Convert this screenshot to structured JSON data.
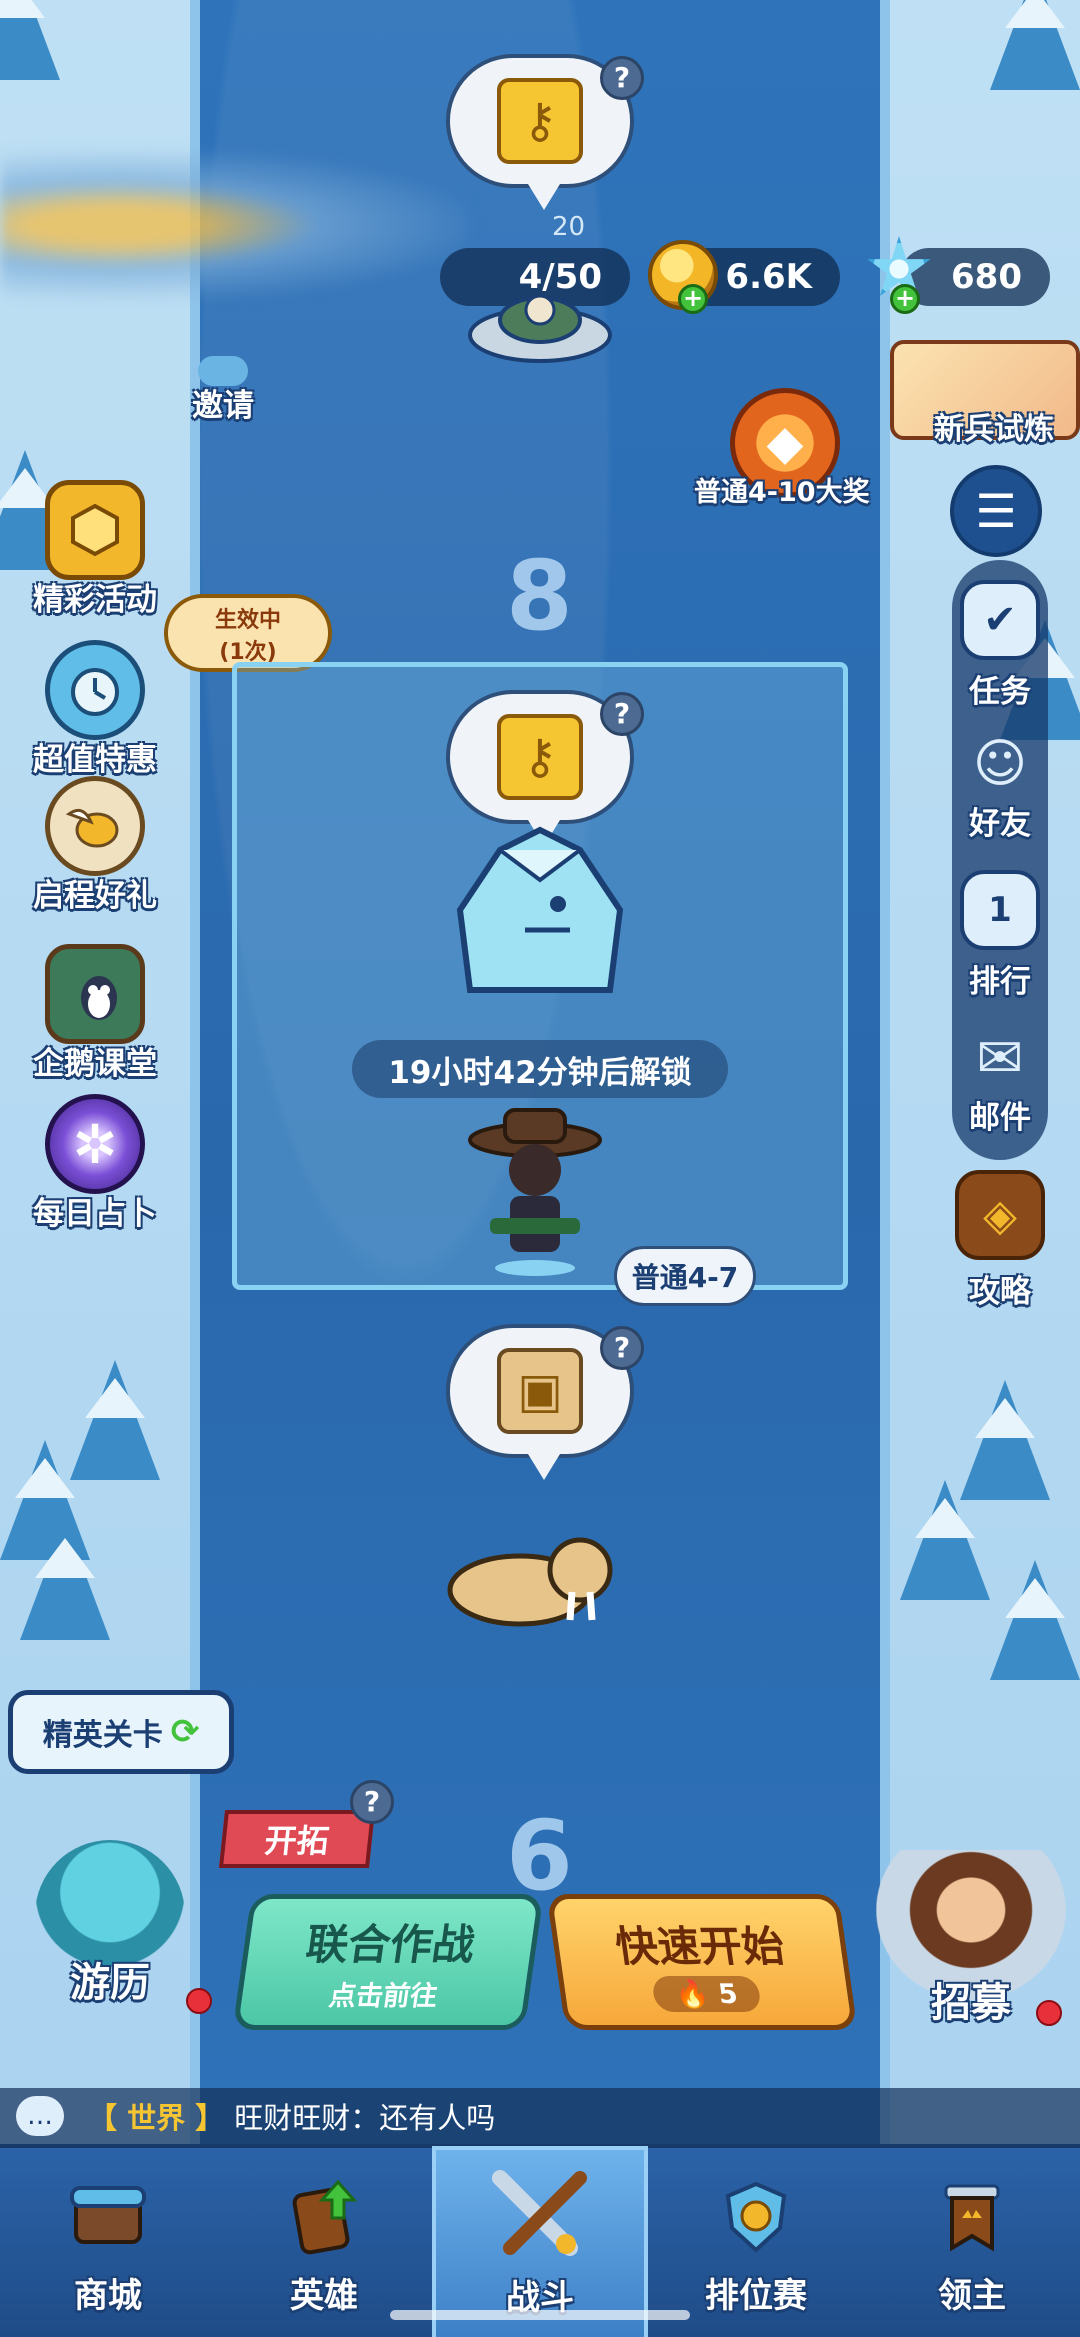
{
  "top_bar": {
    "level_badge": "20",
    "energy": "4/50",
    "coins": "6.6K",
    "gems": "680"
  },
  "left_menu": {
    "invite": "邀请",
    "events": "精彩活动",
    "active_badge_title": "生效中",
    "active_badge_sub": "(1次)",
    "deals": "超值特惠",
    "journey_gift": "启程好礼",
    "penguin_class": "企鹅课堂",
    "daily_divination": "每日占卜",
    "elite_stages": "精英关卡",
    "pioneer": "开拓",
    "travel": "游历"
  },
  "right_menu": {
    "recruit_trial": "新兵试炼",
    "grand_prize": "普通4-10大奖",
    "tasks": "任务",
    "friends": "好友",
    "ranking": "排行",
    "ranking_icon_num": "1",
    "mail": "邮件",
    "guide": "攻略",
    "recruit": "招募"
  },
  "stage": {
    "upper_number": "8",
    "lower_number": "6",
    "unlock_text": "19小时42分钟后解锁",
    "current_tag": "普通4-7"
  },
  "actions": {
    "coop_title": "联合作战",
    "coop_sub": "点击前往",
    "quick_title": "快速开始",
    "quick_cost": "5"
  },
  "chat": {
    "channel": "【 世界 】",
    "message": "旺财旺财：还有人吗"
  },
  "nav": {
    "shop": "商城",
    "heroes": "英雄",
    "battle": "战斗",
    "ranked": "排位赛",
    "lord": "领主"
  },
  "icons": {
    "key": "key-icon",
    "chest": "chest-icon",
    "chat": "chat-icon",
    "flame": "flame-icon"
  },
  "colors": {
    "river": "#2d6fb3",
    "coop_button": "#4cc7a6",
    "quick_button": "#f7a83a",
    "pioneer_tag": "#e04a55"
  }
}
